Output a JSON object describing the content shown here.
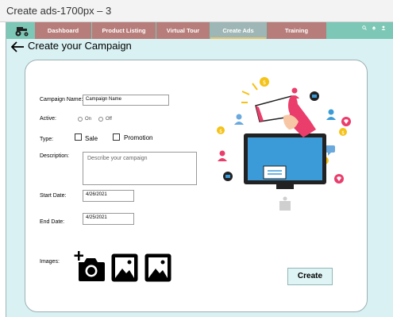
{
  "window": {
    "title": "Create ads-1700px – 3"
  },
  "nav": {
    "tabs": [
      {
        "label": "Dashboard"
      },
      {
        "label": "Product Listing"
      },
      {
        "label": "Virtual Tour"
      },
      {
        "label": "Create Ads",
        "active": true
      },
      {
        "label": "Training"
      }
    ],
    "icons": [
      "search-icon",
      "bell-icon",
      "user-icon"
    ]
  },
  "page": {
    "title": "Create your Campaign"
  },
  "form": {
    "campaign_name_label": "Campaign Name:",
    "campaign_name_value": "Campaign Name",
    "active_label": "Active:",
    "active_on": "On",
    "active_off": "Off",
    "type_label": "Type:",
    "type_sale": "Sale",
    "type_promotion": "Promotion",
    "description_label": "Description:",
    "description_placeholder": "Describe your campaign",
    "start_date_label": "Start Date:",
    "start_date_value": "4/26/2021",
    "end_date_label": "End Date:",
    "end_date_value": "4/25/2021",
    "images_label": "Images:",
    "create_button": "Create"
  },
  "colors": {
    "nav_bg": "#7cc7b5",
    "tab_bg": "#b77d7a",
    "tab_active_bg": "#9fb6b6",
    "content_bg": "#d9f1f3",
    "illustration_pink": "#ea3d6b",
    "illustration_blue": "#3b9bd8",
    "illustration_yellow": "#f5c216"
  }
}
